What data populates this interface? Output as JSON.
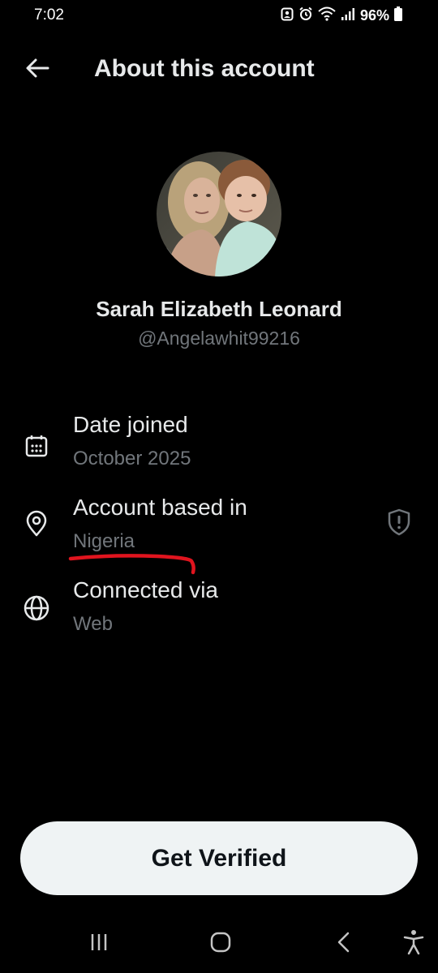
{
  "status_bar": {
    "time": "7:02",
    "battery": "96%",
    "icons": [
      "profile-notification-icon",
      "alarm-icon",
      "wifi-icon",
      "signal-icon",
      "battery-icon"
    ]
  },
  "header": {
    "title": "About this account",
    "back_icon": "arrow-left-icon"
  },
  "profile": {
    "name": "Sarah Elizabeth Leonard",
    "handle": "@Angelawhit99216",
    "avatar": "profile-photo"
  },
  "info": {
    "date_joined": {
      "title": "Date joined",
      "value": "October 2025",
      "icon": "calendar-icon"
    },
    "based_in": {
      "title": "Account based in",
      "value": "Nigeria",
      "icon": "location-pin-icon",
      "action_icon": "shield-alert-icon"
    },
    "connected_via": {
      "title": "Connected via",
      "value": "Web",
      "icon": "globe-icon"
    }
  },
  "cta": {
    "label": "Get Verified"
  },
  "nav_bar": {
    "icons": [
      "recent-apps-icon",
      "home-icon",
      "back-icon",
      "accessibility-icon"
    ]
  },
  "colors": {
    "background": "#000000",
    "primary_text": "#e7e9ea",
    "secondary_text": "#71767b",
    "button_bg": "#eff3f4",
    "button_text": "#0f1419",
    "annotation": "#e0141e"
  }
}
